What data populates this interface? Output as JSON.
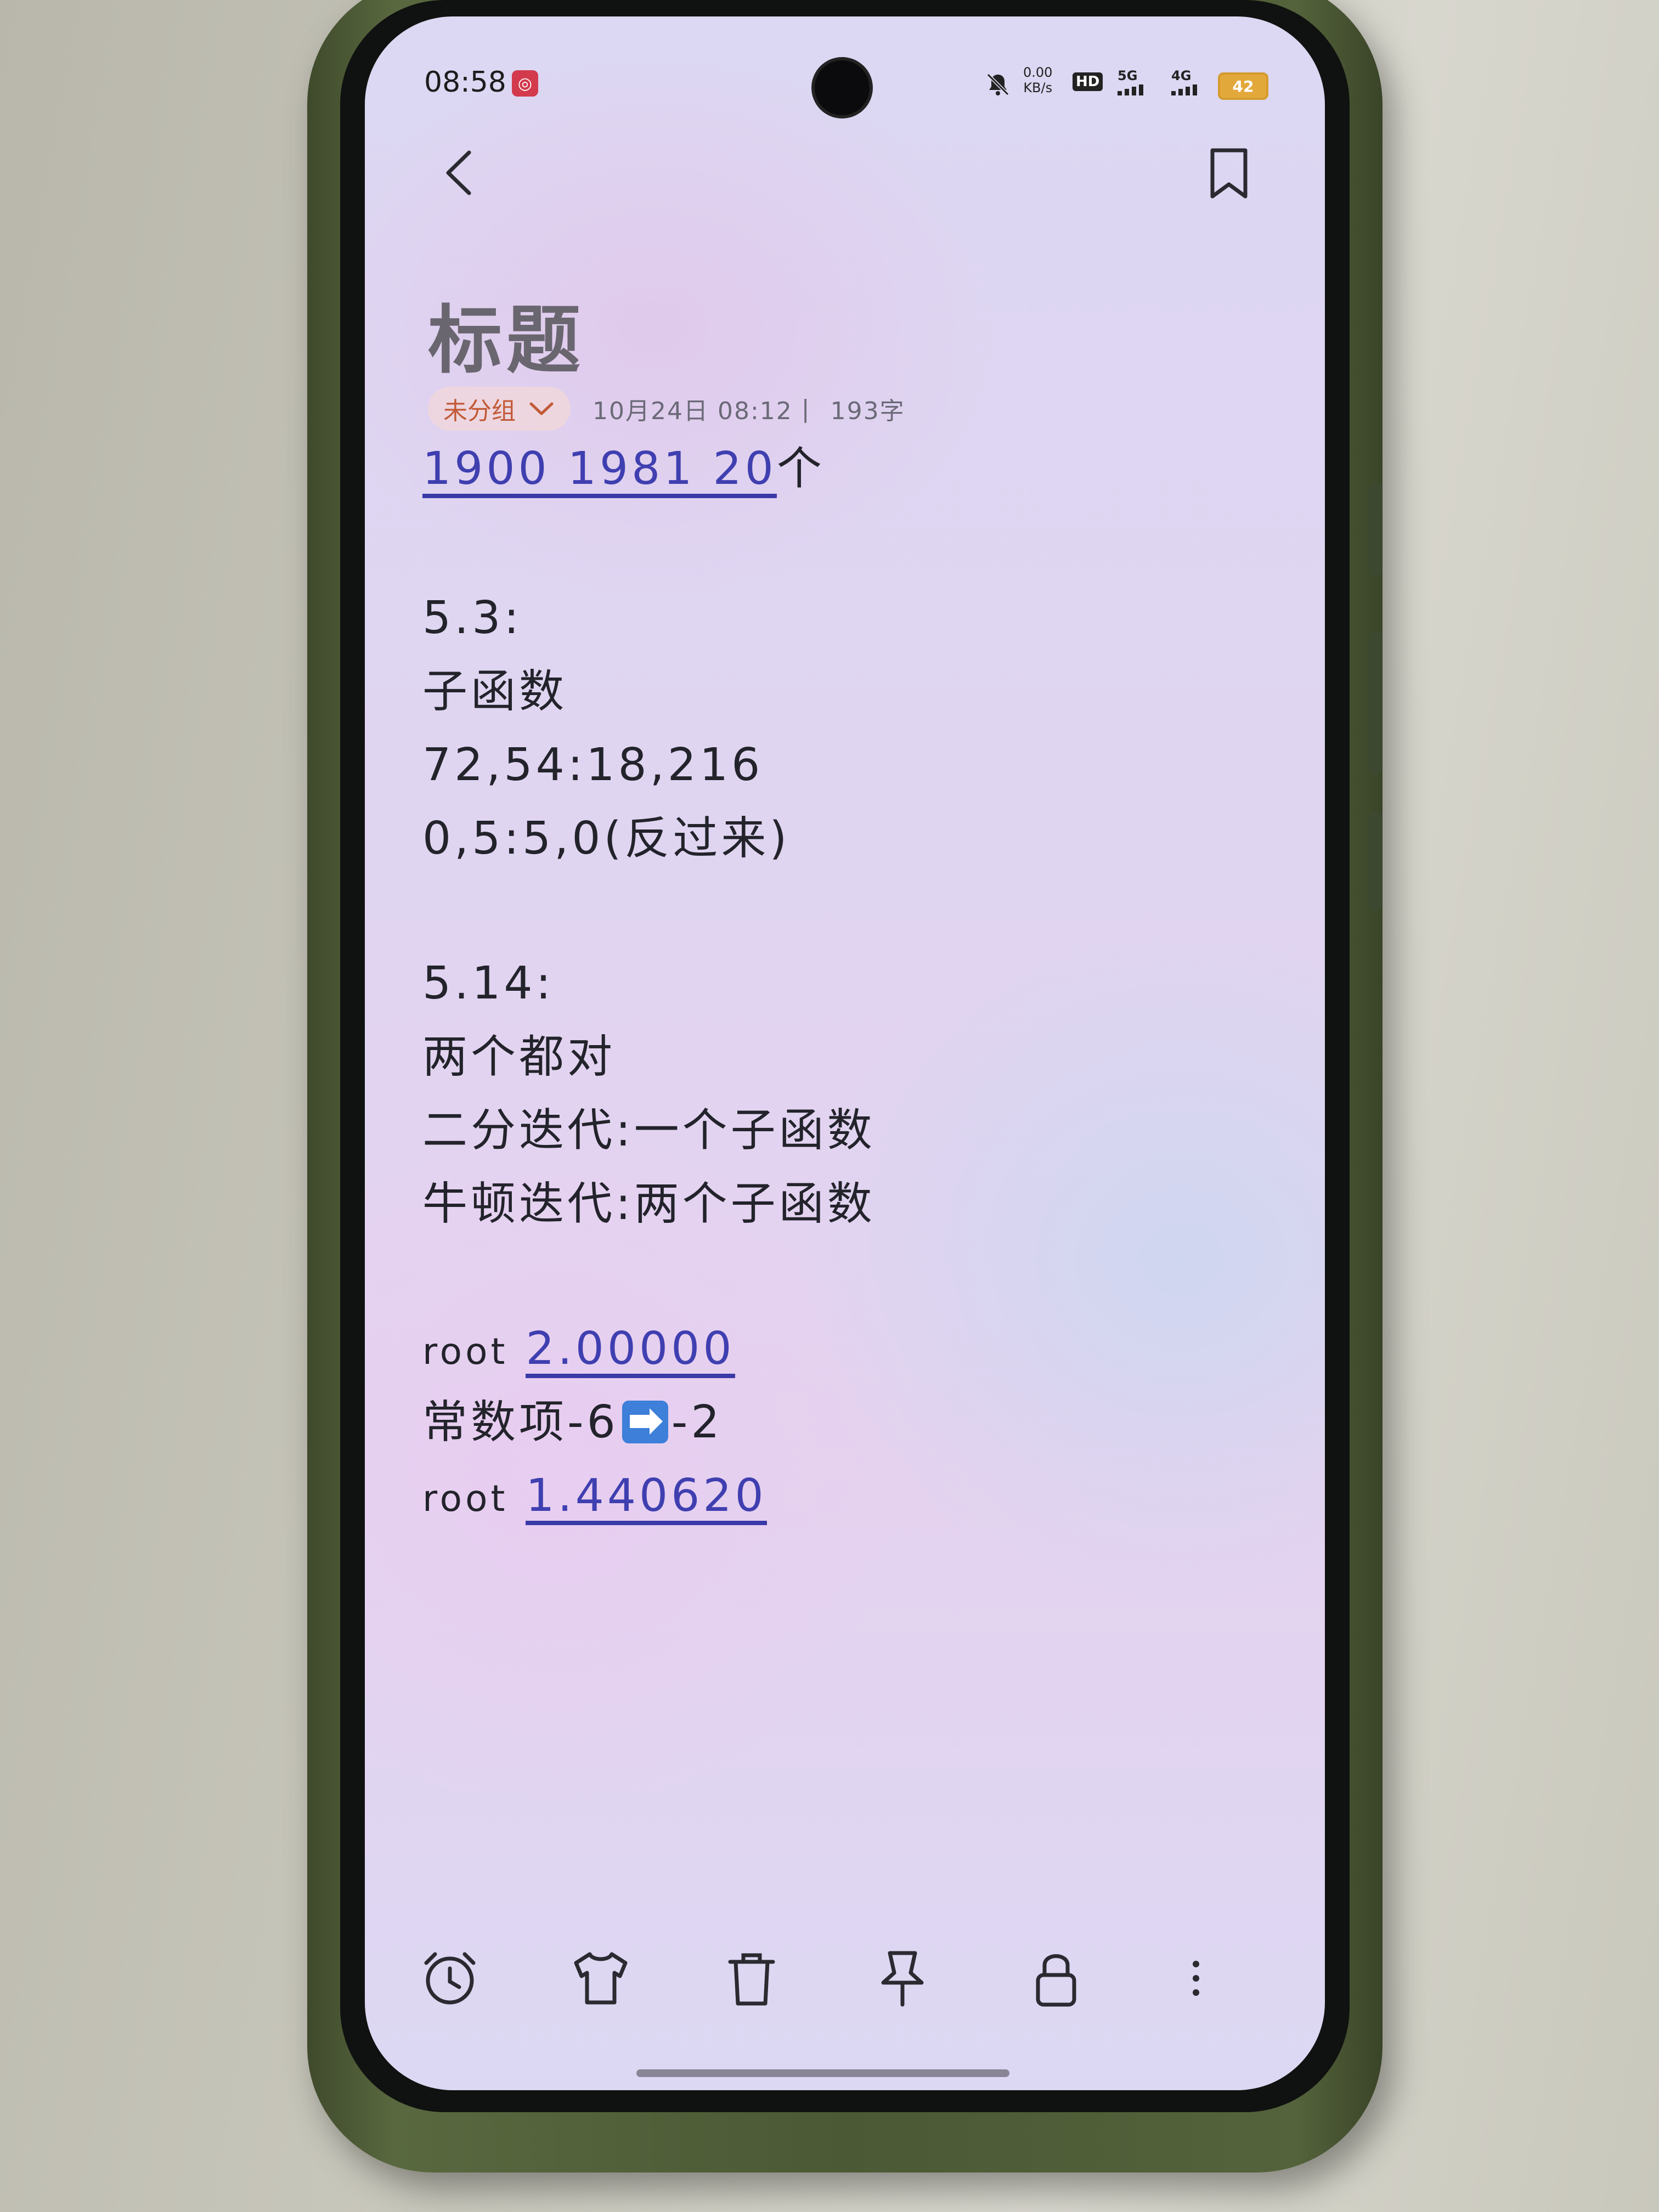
{
  "status_bar": {
    "time": "08:58",
    "net_speed_value": "0.00",
    "net_speed_unit": "KB/s",
    "hd_label": "HD",
    "network_5g": "5G",
    "network_4g": "4G",
    "battery_level": "42",
    "icons": [
      "notification-app-icon",
      "mute-icon",
      "signal-5g-icon",
      "signal-4g-icon",
      "battery-icon"
    ]
  },
  "header": {
    "back_icon": "chevron-left-icon",
    "bookmark_icon": "bookmark-icon"
  },
  "note": {
    "title": "标题",
    "group_label": "未分组",
    "datetime": "10月24日 08:12",
    "separator": "|",
    "word_count": "193字",
    "lines": {
      "l1_link": "1900 1981 20",
      "l1_suffix": "个",
      "l2": "5.3:",
      "l3": "子函数",
      "l4": "72,54:18,216",
      "l5": "0,5:5,0(反过来)",
      "l6": "5.14:",
      "l7": "两个都对",
      "l8": "二分迭代:一个子函数",
      "l9": "牛顿迭代:两个子函数",
      "l10_prefix": "root",
      "l10_link": "2.00000",
      "l11_prefix": "常数项-6",
      "l11_suffix": "-2",
      "l12_prefix": "root",
      "l12_link": "1.440620"
    }
  },
  "bottom_toolbar": {
    "icons": [
      "alarm-clock-icon",
      "tshirt-icon",
      "trash-icon",
      "pin-icon",
      "lock-icon",
      "more-vertical-icon"
    ]
  },
  "colors": {
    "link": "#3f3fb0",
    "chip_text": "#c25a38",
    "body_text": "#23232b",
    "title_text": "#6a6670",
    "case_green": "#4b5935"
  }
}
